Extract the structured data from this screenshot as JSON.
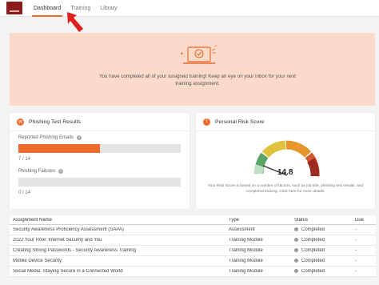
{
  "nav": {
    "logo_text": "infosec",
    "tabs": [
      {
        "label": "Dashboard",
        "active": true
      },
      {
        "label": "Training",
        "active": false
      },
      {
        "label": "Library",
        "active": false
      }
    ]
  },
  "banner": {
    "message": "You have completed all of your assigned training! Keep an eye on your inbox for your next training assignment."
  },
  "phishing": {
    "title": "Phishing Test Results",
    "reported_label": "Reported Phishing Emails",
    "reported_count": "7 / 14",
    "reported_fraction": 0.5,
    "failures_label": "Phishing Failures",
    "failures_count": "0 / 14",
    "failures_fraction": 0
  },
  "risk": {
    "title": "Personal Risk Score",
    "score": "14.8",
    "score_value": 14.8,
    "min": "0",
    "max": "100",
    "description": "Your Risk Score is based on a number of factors, such as job title, phishing test results, and completed training. Click here for more details."
  },
  "table": {
    "headers": [
      "Assignment Name",
      "Type",
      "Status",
      "Due"
    ],
    "rows": [
      {
        "name": "Security Awareness Proficiency Assessment (SAPA)",
        "type": "Assessment",
        "status": "Completed",
        "due": "-"
      },
      {
        "name": "2022 Your Role: Internet Security and You",
        "type": "Training Module",
        "status": "Completed",
        "due": "-"
      },
      {
        "name": "Creating Strong Passwords - Security Awareness Training",
        "type": "Training Module",
        "status": "Completed",
        "due": "-"
      },
      {
        "name": "Mobile Device Security",
        "type": "Training Module",
        "status": "Completed",
        "due": "-"
      },
      {
        "name": "Social Media: Staying Secure in a Connected World",
        "type": "Training Module",
        "status": "Completed",
        "due": "-"
      }
    ]
  },
  "colors": {
    "accent": "#f06a2c",
    "banner_bg": "#fcdacb",
    "arrow": "#e0201b"
  }
}
